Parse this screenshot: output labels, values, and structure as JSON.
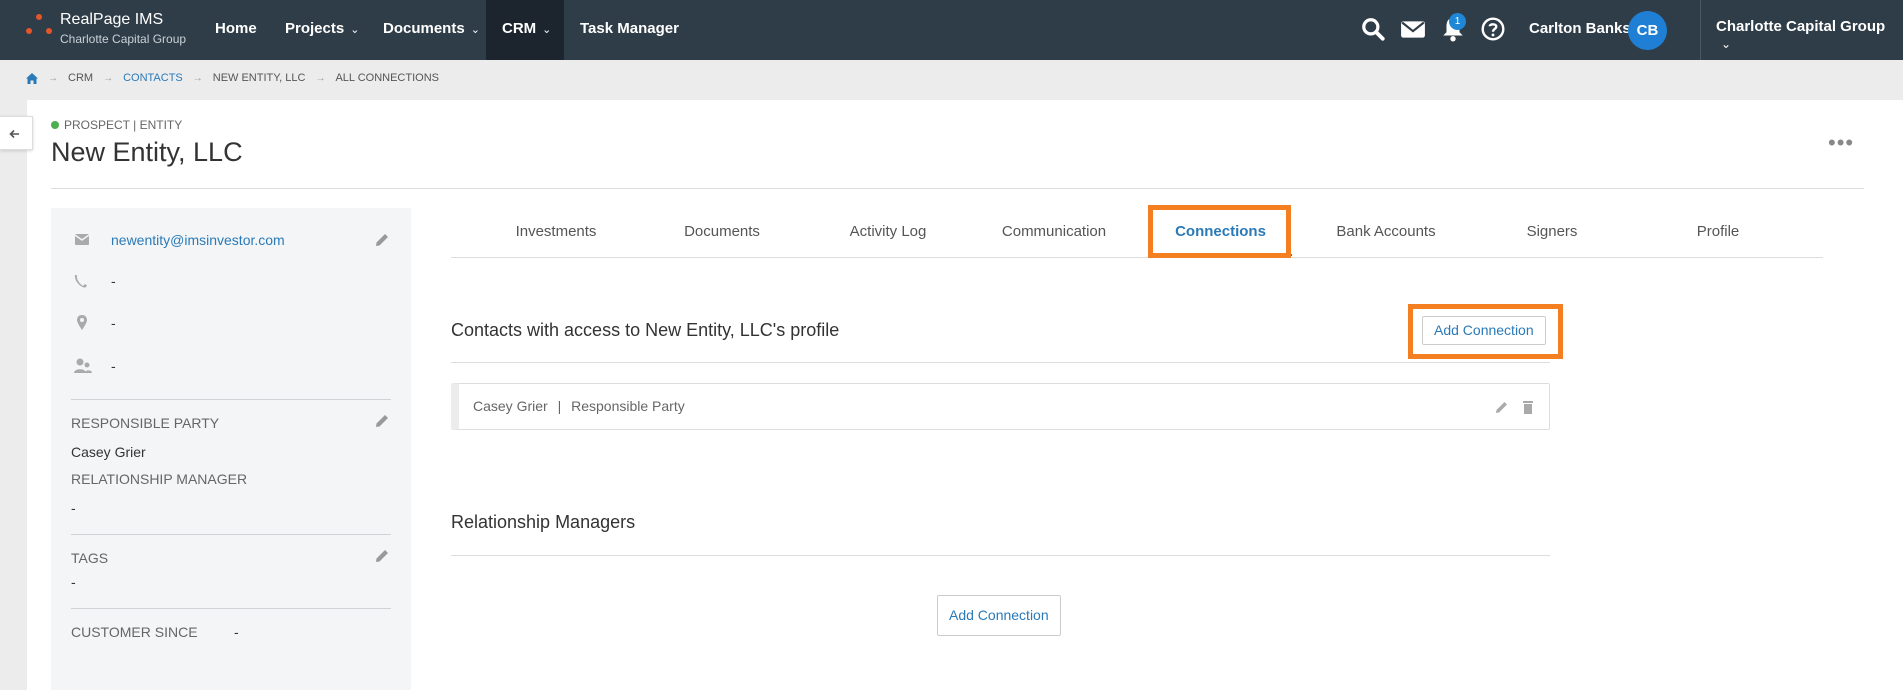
{
  "app": {
    "name": "RealPage IMS",
    "org": "Charlotte Capital Group"
  },
  "nav": {
    "items": [
      {
        "label": "Home",
        "dropdown": false
      },
      {
        "label": "Projects",
        "dropdown": true
      },
      {
        "label": "Documents",
        "dropdown": true
      },
      {
        "label": "CRM",
        "dropdown": true,
        "active": true
      },
      {
        "label": "Task Manager",
        "dropdown": false
      }
    ],
    "notification_count": "1",
    "user_name": "Carlton Banks",
    "user_initials": "CB",
    "org_switch": "Charlotte Capital Group",
    "chevron": "⌄",
    "accent_color": "#2a7ab8",
    "bar_color": "#2f3d48"
  },
  "breadcrumb": {
    "items": [
      "CRM",
      "CONTACTS",
      "NEW ENTITY, LLC",
      "ALL CONNECTIONS"
    ]
  },
  "entity": {
    "status": "PROSPECT | ENTITY",
    "name": "New Entity, LLC",
    "more": "•••"
  },
  "sidebar": {
    "email": "newentity@imsinvestor.com",
    "phone": "-",
    "address": "-",
    "contact": "-",
    "responsible_party_label": "RESPONSIBLE PARTY",
    "responsible_party": "Casey Grier",
    "relationship_manager_label": "RELATIONSHIP MANAGER",
    "relationship_manager": "-",
    "tags_label": "TAGS",
    "tags": "-",
    "customer_since_label": "CUSTOMER SINCE",
    "customer_since": "-"
  },
  "tabs": [
    {
      "label": "Investments"
    },
    {
      "label": "Documents"
    },
    {
      "label": "Activity Log"
    },
    {
      "label": "Communication"
    },
    {
      "label": "Connections",
      "active": true
    },
    {
      "label": "Bank Accounts"
    },
    {
      "label": "Signers"
    },
    {
      "label": "Profile"
    }
  ],
  "main": {
    "contacts_title": "Contacts with access to New Entity, LLC's profile",
    "add_connection_label": "Add Connection",
    "connection": {
      "name": "Casey Grier",
      "separator": "|",
      "role": "Responsible Party"
    },
    "managers_title": "Relationship Managers",
    "add_manager_label": "Add Connection"
  },
  "highlight_color": "#f47f20"
}
